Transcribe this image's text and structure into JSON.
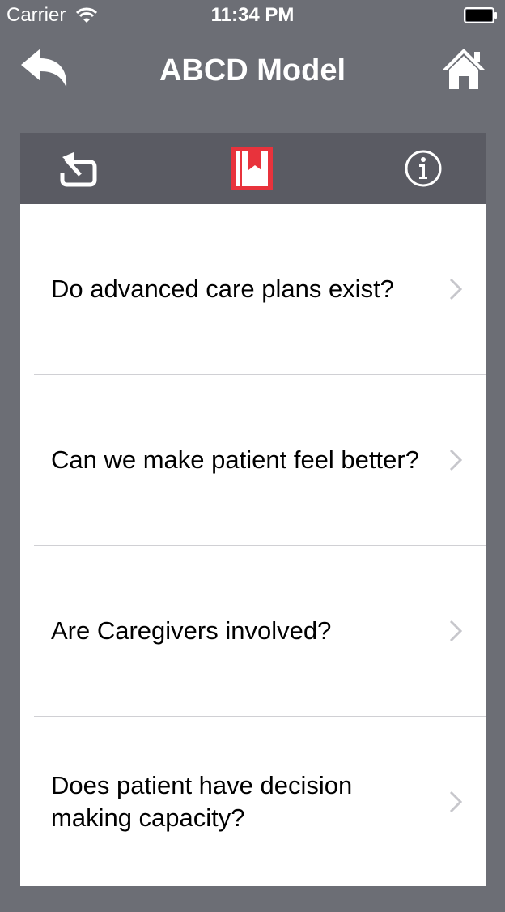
{
  "status_bar": {
    "carrier": "Carrier",
    "time": "11:34 PM"
  },
  "nav": {
    "title": "ABCD Model",
    "back_icon": "back-arrow-icon",
    "home_icon": "home-icon"
  },
  "toolbar": {
    "items": [
      {
        "icon": "return-icon"
      },
      {
        "icon": "bookmark-icon",
        "color": "#e8333c"
      },
      {
        "icon": "info-icon"
      }
    ]
  },
  "list": {
    "items": [
      {
        "label": "Do advanced care plans exist?"
      },
      {
        "label": "Can we make patient feel better?"
      },
      {
        "label": "Are Caregivers involved?"
      },
      {
        "label": "Does patient have decision making capacity?"
      }
    ]
  },
  "colors": {
    "background": "#6c6e75",
    "toolbar": "#5a5b63",
    "accent": "#e8333c"
  }
}
